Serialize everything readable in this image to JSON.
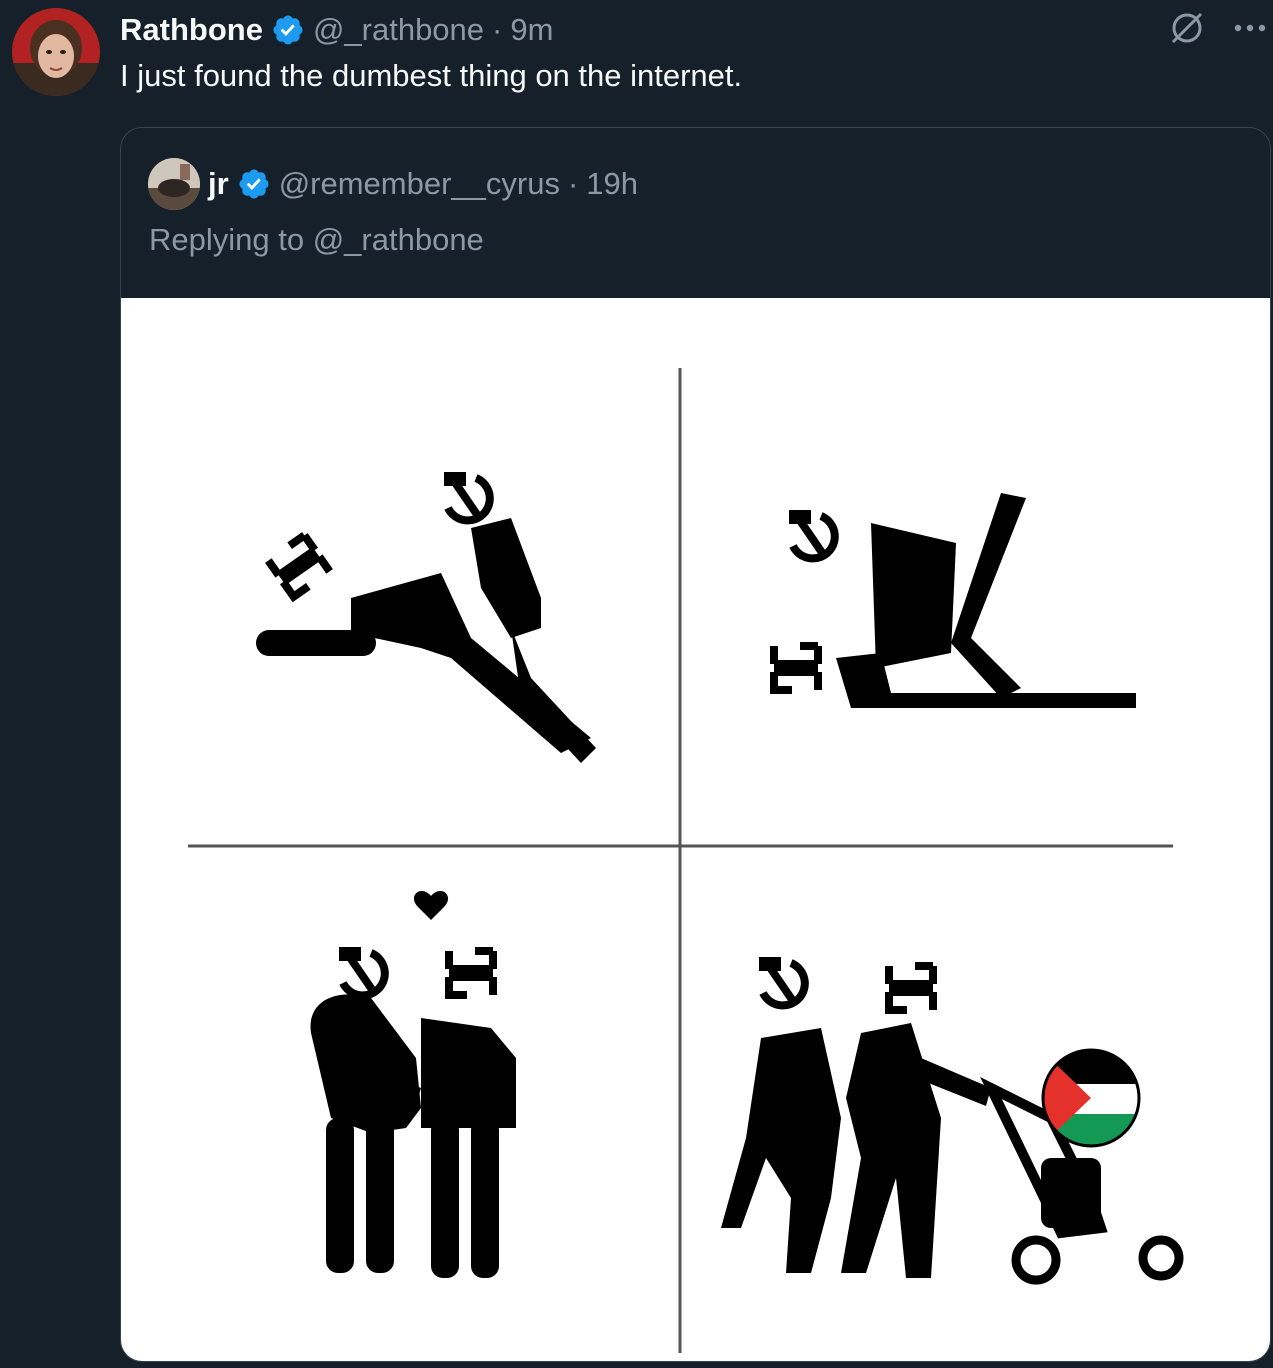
{
  "tweet": {
    "author_name": "Rathbone",
    "author_handle": "@_rathbone",
    "separator": "·",
    "time": "9m",
    "text": "I just found the dumbest thing on the internet."
  },
  "quoted": {
    "author_name": "jr",
    "author_handle": "@remember__cyrus",
    "separator": "·",
    "time": "19h",
    "replying_to": "Replying to @_rathbone"
  },
  "icons": {
    "verified": "verified-badge-icon",
    "grok": "grok-icon",
    "more": "more-icon",
    "meme": "four-panel-pictogram-meme"
  },
  "colors": {
    "background": "#15202b",
    "secondary_text": "#8b98a5",
    "verified_blue": "#1d9bf0",
    "border": "#38444d"
  }
}
